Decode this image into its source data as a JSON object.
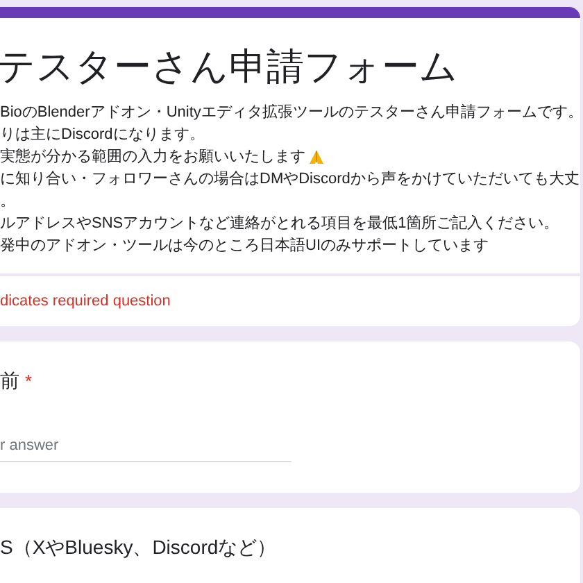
{
  "form": {
    "title": "テスターさん申請フォーム",
    "description": [
      "BioのBlenderアドオン・Unityエディタ拡張ツールのテスターさん申請フォームです。",
      "りは主にDiscordになります。",
      "実態が分かる範囲の入力をお願いいたします",
      "に知り合い・フォロワーさんの場合はDMやDiscordから声をかけていただいても大丈",
      "。",
      "ルアドレスやSNSアカウントなど連絡がとれる項目を最低1箇所ご記入ください。",
      "発中のアドオン・ツールは今のところ日本語UIのみサポートしています"
    ],
    "required_note": "dicates required question"
  },
  "questions": [
    {
      "title": "前",
      "required_mark": "*",
      "placeholder": "r answer"
    },
    {
      "title": "S（XやBluesky、Discordなど）"
    }
  ]
}
